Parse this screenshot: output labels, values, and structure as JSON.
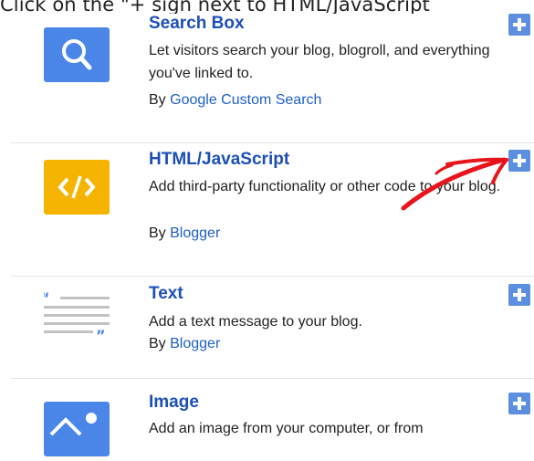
{
  "caption": "Click on the \"+ sign next to HTML/JavaScript",
  "gadgets": [
    {
      "title": "Search Box",
      "description": "Let visitors search your blog, blogroll, and everything you've linked to.",
      "by_prefix": "By",
      "author": "Google Custom Search",
      "icon": "search-icon",
      "icon_color": "#4a86e8"
    },
    {
      "title": "HTML/JavaScript",
      "description": "Add third-party functionality or other code to your blog.",
      "by_prefix": "By",
      "author": "Blogger",
      "icon": "code-icon",
      "icon_color": "#f4b400"
    },
    {
      "title": "Text",
      "description": "Add a text message to your blog.",
      "by_prefix": "By",
      "author": "Blogger",
      "icon": "text-lines-icon",
      "icon_color": "#9aa0a6"
    },
    {
      "title": "Image",
      "description": "Add an image from your computer, or from",
      "icon": "image-icon",
      "icon_color": "#4a86e8"
    }
  ],
  "add_button_color": "#5c8fe0",
  "annotation_color": "#e8141b"
}
